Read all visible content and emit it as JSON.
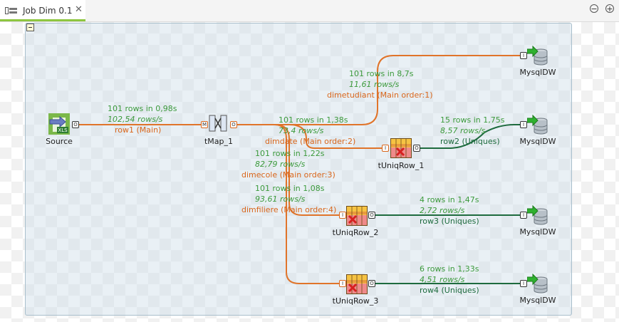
{
  "tab": {
    "title": "Job Dim 0.1",
    "close": "✕"
  },
  "window": {
    "minimize": "−",
    "maximize": "+"
  },
  "components": {
    "source": "Source",
    "tmap": "tMap_1",
    "uniq1": "tUniqRow_1",
    "uniq2": "tUniqRow_2",
    "uniq3": "tUniqRow_3",
    "db1": "MysqlDW",
    "db2": "MysqlDW",
    "db3": "MysqlDW",
    "db4": "MysqlDW"
  },
  "xls_label": "XLS",
  "flows": {
    "row1": {
      "stat": "101 rows in 0,98s",
      "rate": "102,54 rows/s",
      "label": "row1 (Main)"
    },
    "dimetudiant": {
      "stat": "101 rows in 8,7s",
      "rate": "11,61 rows/s",
      "label": "dimetudiant (Main order:1)"
    },
    "dimdate": {
      "stat": "101 rows in 1,38s",
      "rate": "73,4 rows/s",
      "label": "dimdate (Main order:2)"
    },
    "dimecole": {
      "stat": "101 rows in 1,22s",
      "rate": "82,79 rows/s",
      "label": "dimecole (Main order:3)"
    },
    "dimfiliere": {
      "stat": "101 rows in 1,08s",
      "rate": "93,61 rows/s",
      "label": "dimfiliere (Main order:4)"
    },
    "row2": {
      "stat": "15 rows in 1,75s",
      "rate": "8,57 rows/s",
      "label": "row2 (Uniques)"
    },
    "row3": {
      "stat": "4 rows in 1,47s",
      "rate": "2,72 rows/s",
      "label": "row3 (Uniques)"
    },
    "row4": {
      "stat": "6 rows in 1,33s",
      "rate": "4,51 rows/s",
      "label": "row4 (Uniques)"
    }
  },
  "colors": {
    "main_flow": "#e0742a",
    "uniques_flow": "#1e6b3e",
    "subjob_bg": "#dce8ef",
    "tab_accent": "#8dc63f"
  }
}
